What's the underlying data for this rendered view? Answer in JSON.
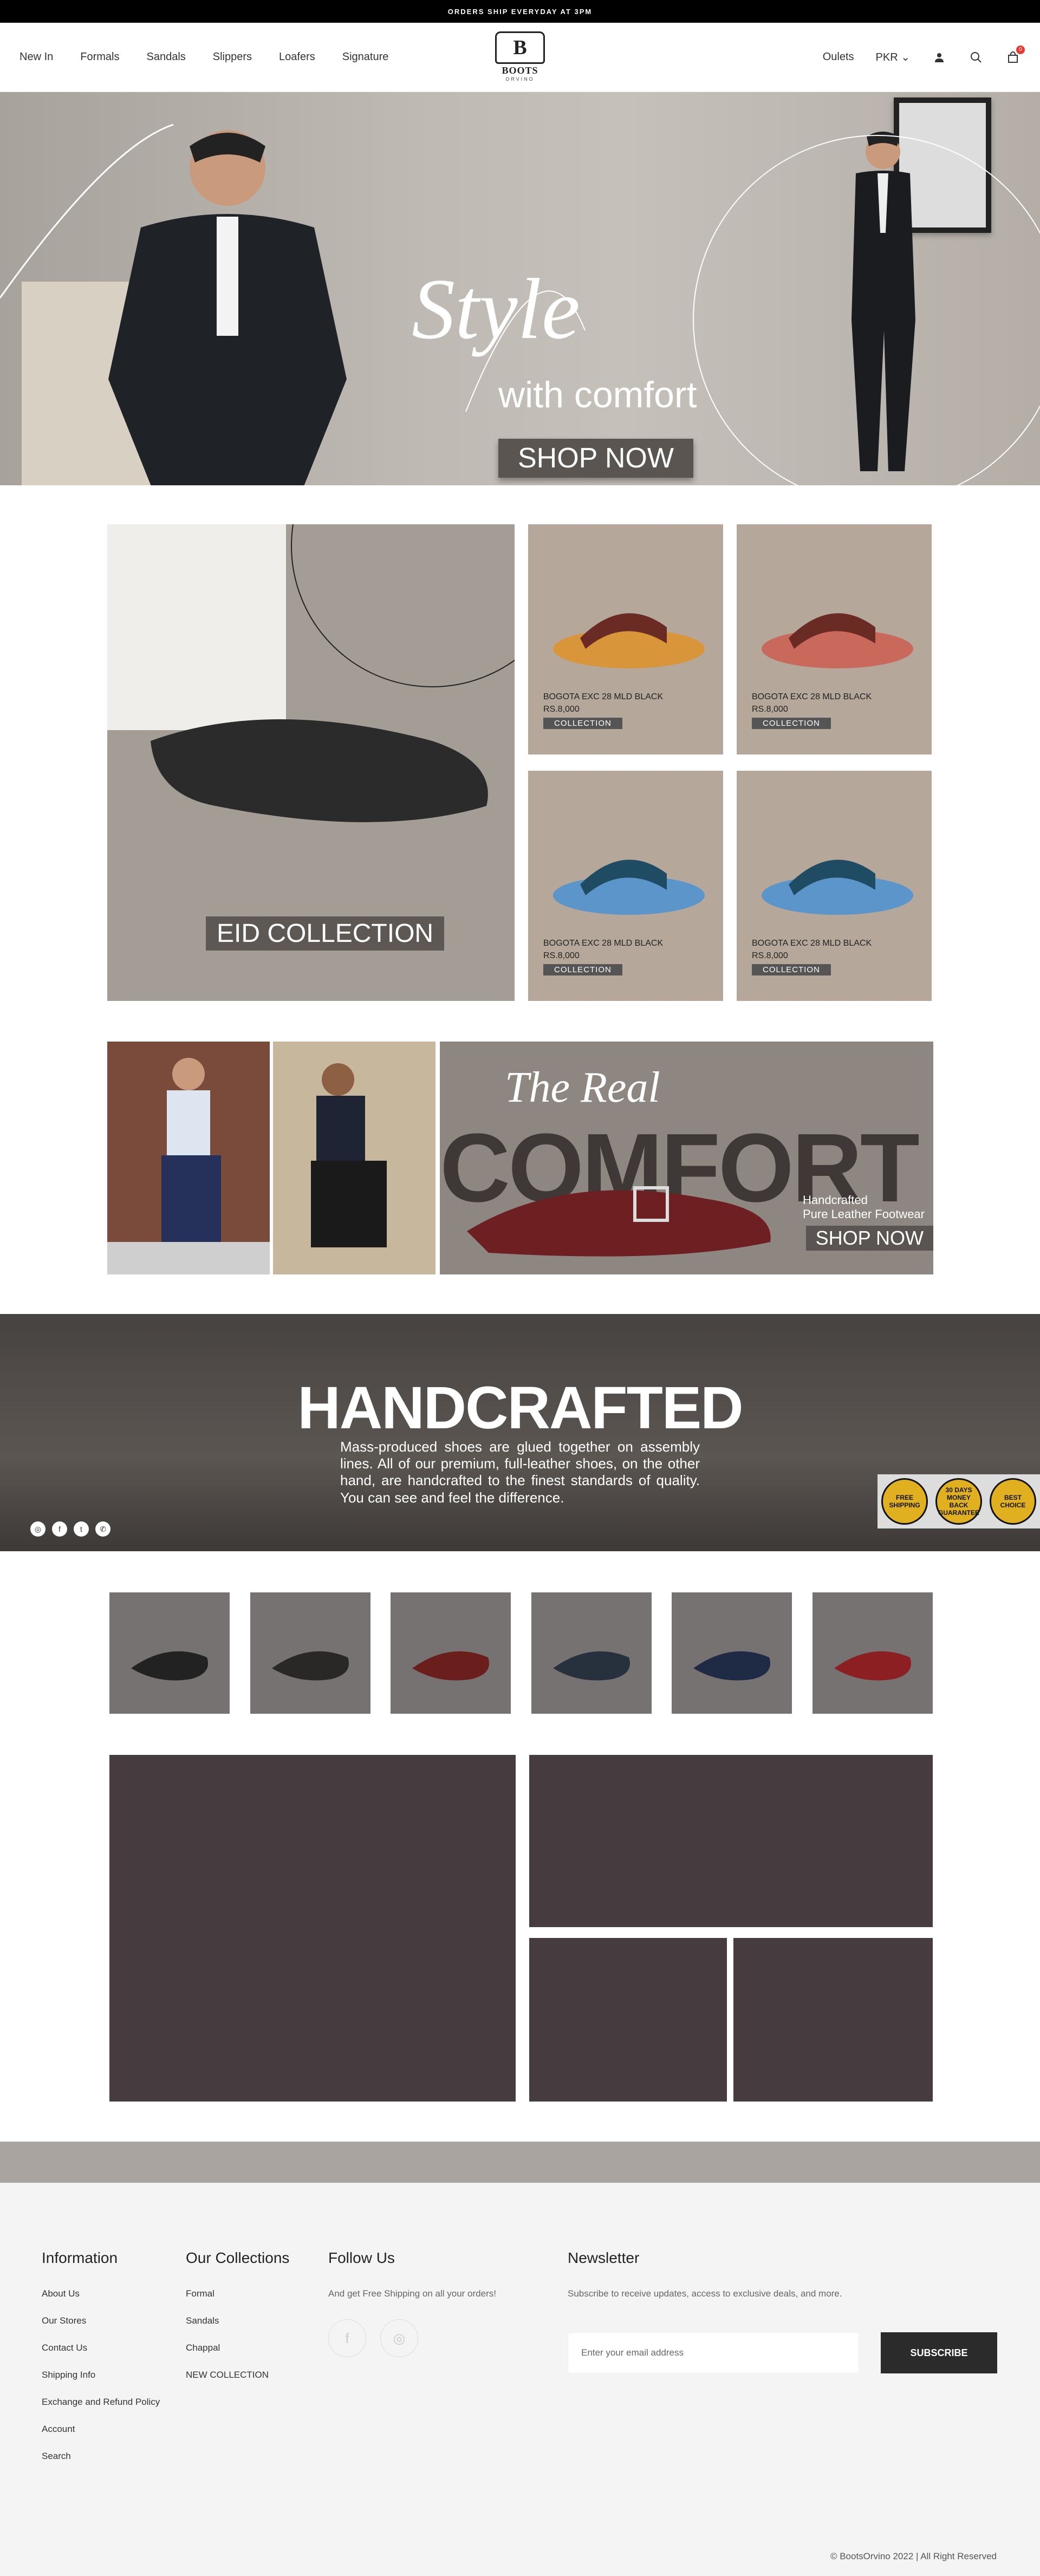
{
  "topbar": {
    "text": "ORDERS SHIP EVERYDAY AT 3PM"
  },
  "nav": {
    "left": [
      "New In",
      "Formals",
      "Sandals",
      "Slippers",
      "Loafers",
      "Signature"
    ],
    "right": {
      "outlets": "Oulets",
      "currency": "PKR",
      "cart_count": "0"
    }
  },
  "logo": {
    "mark": "B",
    "name": "BOOTS",
    "sub": "ORVINO"
  },
  "hero": {
    "script": "Style",
    "tagline": "with comfort",
    "cta": "SHOP NOW"
  },
  "eid": {
    "label": "EID COLLECTION"
  },
  "products": [
    {
      "name": "BOGOTA EXC 28 MLD BLACK",
      "price": "RS.8,000",
      "cta": "COLLECTION"
    },
    {
      "name": "BOGOTA EXC 28 MLD BLACK",
      "price": "RS.8,000",
      "cta": "COLLECTION"
    },
    {
      "name": "BOGOTA EXC 28 MLD BLACK",
      "price": "RS.8,000",
      "cta": "COLLECTION"
    },
    {
      "name": "BOGOTA EXC 28 MLD BLACK",
      "price": "RS.8,000",
      "cta": "COLLECTION"
    }
  ],
  "banner2": {
    "script": "The Real",
    "big": "COMFORT",
    "line1": "Handcrafted",
    "line2": "Pure Leather Footwear",
    "cta": "SHOP NOW"
  },
  "handcrafted": {
    "title": "HANDCRAFTED",
    "desc": "Mass-produced shoes are glued together on assembly lines. All of our premium, full-leather shoes, on the other hand, are handcrafted to the finest standards of quality. You can see and feel the difference.",
    "badges": [
      "FREE SHIPPING",
      "30 DAYS MONEY BACK GUARANTEE",
      "BEST CHOICE"
    ]
  },
  "footer": {
    "info_title": "Information",
    "info_links": [
      "About Us",
      "Our Stores",
      "Contact Us",
      "Shipping Info",
      "Exchange and Refund Policy",
      "Account",
      "Search"
    ],
    "coll_title": "Our Collections",
    "coll_links": [
      "Formal",
      "Sandals",
      "Chappal",
      "NEW COLLECTION"
    ],
    "follow_title": "Follow Us",
    "follow_text": "And get Free Shipping on all your orders!",
    "news_title": "Newsletter",
    "news_text": "Subscribe to receive updates, access to exclusive deals, and more.",
    "email_placeholder": "Enter your email address",
    "subscribe": "SUBSCRIBE",
    "copyright": "© BootsOrvino 2022 | All Right Reserved"
  },
  "colors": {
    "accent": "#463b3f",
    "topbar": "#000000",
    "tile": "#b5a79a"
  }
}
